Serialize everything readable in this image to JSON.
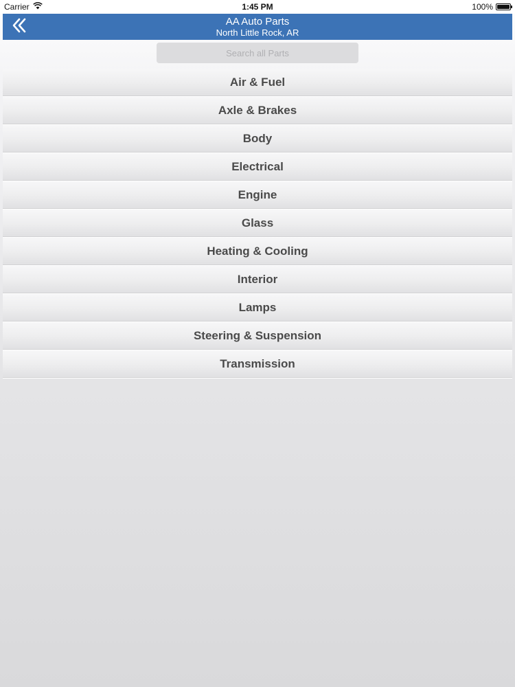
{
  "status_bar": {
    "carrier": "Carrier",
    "time": "1:45 PM",
    "battery": "100%"
  },
  "nav": {
    "title": "AA Auto Parts",
    "subtitle": "North Little Rock, AR",
    "back_icon": "double-chevron-left-icon",
    "background_color": "#3c73b6"
  },
  "search": {
    "placeholder": "Search all Parts",
    "value": ""
  },
  "categories": [
    {
      "label": "Air & Fuel"
    },
    {
      "label": "Axle & Brakes"
    },
    {
      "label": "Body"
    },
    {
      "label": "Electrical"
    },
    {
      "label": "Engine"
    },
    {
      "label": "Glass"
    },
    {
      "label": "Heating & Cooling"
    },
    {
      "label": "Interior"
    },
    {
      "label": "Lamps"
    },
    {
      "label": "Steering & Suspension"
    },
    {
      "label": "Transmission"
    }
  ]
}
